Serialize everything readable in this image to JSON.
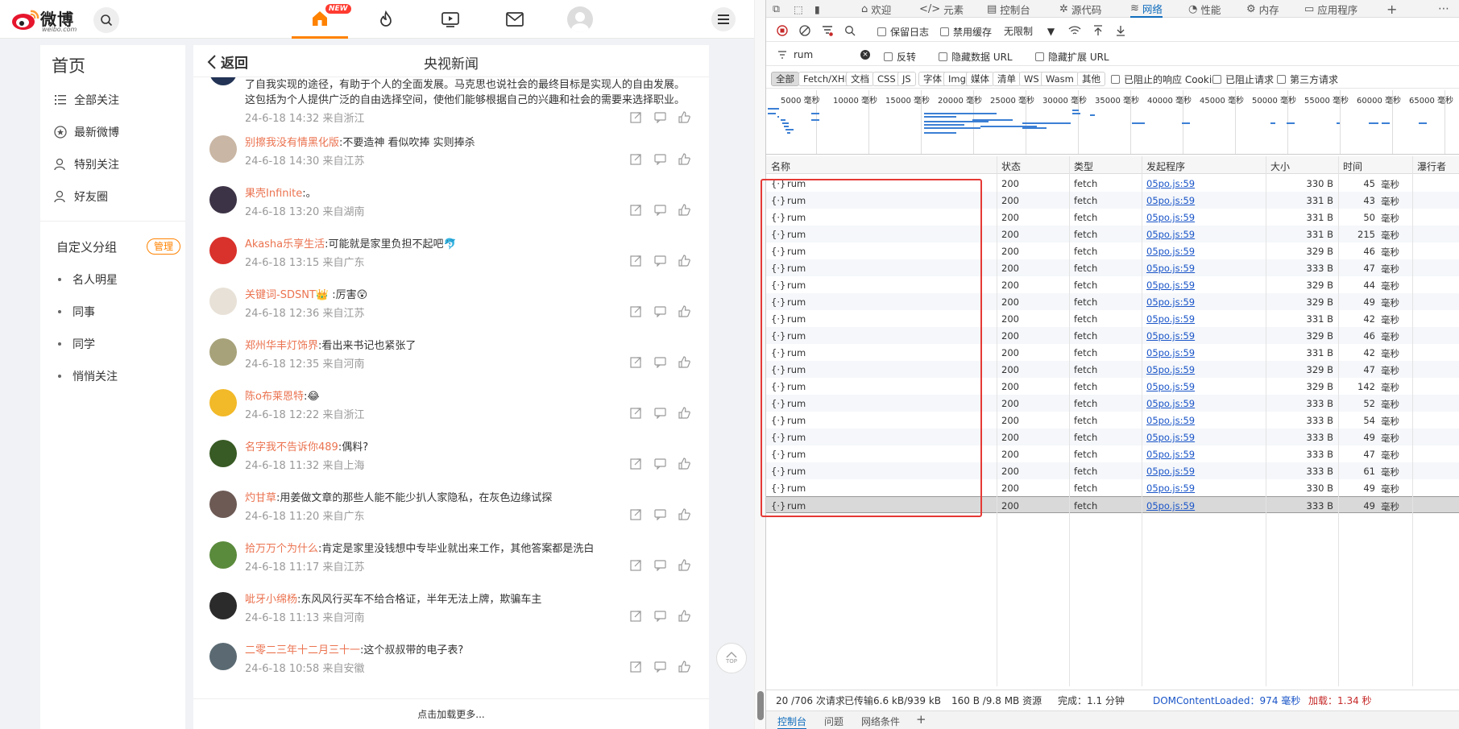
{
  "weibo": {
    "logo_text": "微博",
    "logo_domain": "weibo.com",
    "new_badge": "NEW",
    "left": {
      "home": "首页",
      "items": [
        {
          "label": "全部关注",
          "icon": "list-icon"
        },
        {
          "label": "最新微博",
          "icon": "star-circle-icon"
        },
        {
          "label": "特别关注",
          "icon": "user-star-icon"
        },
        {
          "label": "好友圈",
          "icon": "user-friends-icon"
        }
      ],
      "group_title": "自定义分组",
      "manage": "管理",
      "groups": [
        "名人明星",
        "同事",
        "同学",
        "悄悄关注"
      ]
    },
    "main": {
      "back": "返回",
      "title": "央视新闻",
      "first_lines": [
        "了自我实现的途径，有助于个人的全面发展。马克思也说社会的最终目标是实现人的自由发展。",
        "这包括为个人提供广泛的自由选择空间，使他们能够根据自己的兴趣和社会的需要来选择职业。"
      ],
      "first_meta": "24-6-18 14:32 来自浙江",
      "comments": [
        {
          "user": "别擦我没有情黑化版",
          "text": ":不要造神 看似吹捧 实则捧杀",
          "meta": "24-6-18 14:30 来自江苏",
          "color": "#c9b6a4"
        },
        {
          "user": "果壳Infinite",
          "text": ":。",
          "meta": "24-6-18 13:20 来自湖南",
          "color": "#3d3346"
        },
        {
          "user": "Akasha乐享生活",
          "text": ":可能就是家里负担不起吧🐬",
          "meta": "24-6-18 13:15 来自广东",
          "color": "#d9312b"
        },
        {
          "user": "关键词-SDSNT",
          "text": "👑 :厉害😲",
          "meta": "24-6-18 12:36 来自江苏",
          "color": "#e8e1d7"
        },
        {
          "user": "郑州华丰灯饰界",
          "text": ":看出来书记也紧张了",
          "meta": "24-6-18 12:35 来自河南",
          "color": "#a7a27a"
        },
        {
          "user": "陈o布莱恩特",
          "text": ":😂",
          "meta": "24-6-18 12:22 来自浙江",
          "color": "#f2b928"
        },
        {
          "user": "名字我不告诉你489",
          "text": ":偶料?",
          "meta": "24-6-18 11:32 来自上海",
          "color": "#385a24"
        },
        {
          "user": "灼甘草",
          "text": ":用姜做文章的那些人能不能少扒人家隐私，在灰色边缘试探",
          "meta": "24-6-18 11:20 来自广东",
          "color": "#6d5a55"
        },
        {
          "user": "拾万万个为什么",
          "text": ":肯定是家里没钱想中专毕业就出来工作，其他答案都是洗白",
          "meta": "24-6-18 11:17 来自江苏",
          "color": "#5a8a3c"
        },
        {
          "user": "呲牙小绵杨",
          "text": ":东风风行买车不给合格证，半年无法上牌，欺骗车主",
          "meta": "24-6-18 11:13 来自河南",
          "color": "#2b2b2b"
        },
        {
          "user": "二零二三年十二月三十一",
          "text": ":这个叔叔带的电子表?",
          "meta": "24-6-18 10:58 来自安徽",
          "color": "#5b6a72"
        }
      ],
      "load_more": "点击加载更多..."
    },
    "top_btn": "TOP"
  },
  "devtools": {
    "tabs": [
      {
        "label": "欢迎",
        "icon": "home-icon"
      },
      {
        "label": "元素",
        "icon": "code-icon"
      },
      {
        "label": "控制台",
        "icon": "console-icon"
      },
      {
        "label": "源代码",
        "icon": "bug-icon"
      },
      {
        "label": "网络",
        "icon": "wifi-icon"
      },
      {
        "label": "性能",
        "icon": "gauge-icon"
      },
      {
        "label": "内存",
        "icon": "gear-icon"
      },
      {
        "label": "应用程序",
        "icon": "app-icon"
      }
    ],
    "toolbar": {
      "preserve_log": "保留日志",
      "disable_cache": "禁用缓存",
      "throttle": "无限制"
    },
    "filter": {
      "value": "rum",
      "invert": "反转",
      "hide_data_url": "隐藏数据 URL",
      "hide_ext_url": "隐藏扩展 URL"
    },
    "types": [
      "全部",
      "Fetch/XHR",
      "文档",
      "CSS",
      "JS",
      "字体",
      "Img",
      "媒体",
      "清单",
      "WS",
      "Wasm",
      "其他"
    ],
    "type_checks": [
      "已阻止的响应 Cookie",
      "已阻止请求",
      "第三方请求"
    ],
    "overview_labels": [
      "5000 毫秒",
      "10000 毫秒",
      "15000 毫秒",
      "20000 毫秒",
      "25000 毫秒",
      "30000 毫秒",
      "35000 毫秒",
      "40000 毫秒",
      "45000 毫秒",
      "50000 毫秒",
      "55000 毫秒",
      "60000 毫秒",
      "65000 毫秒"
    ],
    "columns": [
      "名称",
      "状态",
      "类型",
      "发起程序",
      "大小",
      "时间",
      "瀑行者"
    ],
    "rows": [
      {
        "name": "rum",
        "status": "200",
        "type": "fetch",
        "initiator": "05po.js:59",
        "size": "330 B",
        "time": "45",
        "unit": "毫秒"
      },
      {
        "name": "rum",
        "status": "200",
        "type": "fetch",
        "initiator": "05po.js:59",
        "size": "331 B",
        "time": "43",
        "unit": "毫秒"
      },
      {
        "name": "rum",
        "status": "200",
        "type": "fetch",
        "initiator": "05po.js:59",
        "size": "331 B",
        "time": "50",
        "unit": "毫秒"
      },
      {
        "name": "rum",
        "status": "200",
        "type": "fetch",
        "initiator": "05po.js:59",
        "size": "331 B",
        "time": "215",
        "unit": "毫秒"
      },
      {
        "name": "rum",
        "status": "200",
        "type": "fetch",
        "initiator": "05po.js:59",
        "size": "329 B",
        "time": "46",
        "unit": "毫秒"
      },
      {
        "name": "rum",
        "status": "200",
        "type": "fetch",
        "initiator": "05po.js:59",
        "size": "333 B",
        "time": "47",
        "unit": "毫秒"
      },
      {
        "name": "rum",
        "status": "200",
        "type": "fetch",
        "initiator": "05po.js:59",
        "size": "329 B",
        "time": "44",
        "unit": "毫秒"
      },
      {
        "name": "rum",
        "status": "200",
        "type": "fetch",
        "initiator": "05po.js:59",
        "size": "329 B",
        "time": "49",
        "unit": "毫秒"
      },
      {
        "name": "rum",
        "status": "200",
        "type": "fetch",
        "initiator": "05po.js:59",
        "size": "331 B",
        "time": "42",
        "unit": "毫秒"
      },
      {
        "name": "rum",
        "status": "200",
        "type": "fetch",
        "initiator": "05po.js:59",
        "size": "329 B",
        "time": "46",
        "unit": "毫秒"
      },
      {
        "name": "rum",
        "status": "200",
        "type": "fetch",
        "initiator": "05po.js:59",
        "size": "331 B",
        "time": "42",
        "unit": "毫秒"
      },
      {
        "name": "rum",
        "status": "200",
        "type": "fetch",
        "initiator": "05po.js:59",
        "size": "329 B",
        "time": "47",
        "unit": "毫秒"
      },
      {
        "name": "rum",
        "status": "200",
        "type": "fetch",
        "initiator": "05po.js:59",
        "size": "329 B",
        "time": "142",
        "unit": "毫秒"
      },
      {
        "name": "rum",
        "status": "200",
        "type": "fetch",
        "initiator": "05po.js:59",
        "size": "333 B",
        "time": "52",
        "unit": "毫秒"
      },
      {
        "name": "rum",
        "status": "200",
        "type": "fetch",
        "initiator": "05po.js:59",
        "size": "333 B",
        "time": "54",
        "unit": "毫秒"
      },
      {
        "name": "rum",
        "status": "200",
        "type": "fetch",
        "initiator": "05po.js:59",
        "size": "333 B",
        "time": "49",
        "unit": "毫秒"
      },
      {
        "name": "rum",
        "status": "200",
        "type": "fetch",
        "initiator": "05po.js:59",
        "size": "333 B",
        "time": "47",
        "unit": "毫秒"
      },
      {
        "name": "rum",
        "status": "200",
        "type": "fetch",
        "initiator": "05po.js:59",
        "size": "333 B",
        "time": "61",
        "unit": "毫秒"
      },
      {
        "name": "rum",
        "status": "200",
        "type": "fetch",
        "initiator": "05po.js:59",
        "size": "330 B",
        "time": "49",
        "unit": "毫秒"
      },
      {
        "name": "rum",
        "status": "200",
        "type": "fetch",
        "initiator": "05po.js:59",
        "size": "333 B",
        "time": "49",
        "unit": "毫秒"
      }
    ],
    "status": {
      "requests": "20 /706 次请求",
      "transferred": "已传输6.6 kB/939 kB",
      "resources": "160 B /9.8 MB 资源",
      "finish": "完成：1.1 分钟",
      "dcl_label": "DOMContentLoaded：974 毫秒",
      "load_label": "加载：1.34 秒"
    },
    "drawer": [
      "控制台",
      "问题",
      "网络条件"
    ]
  }
}
